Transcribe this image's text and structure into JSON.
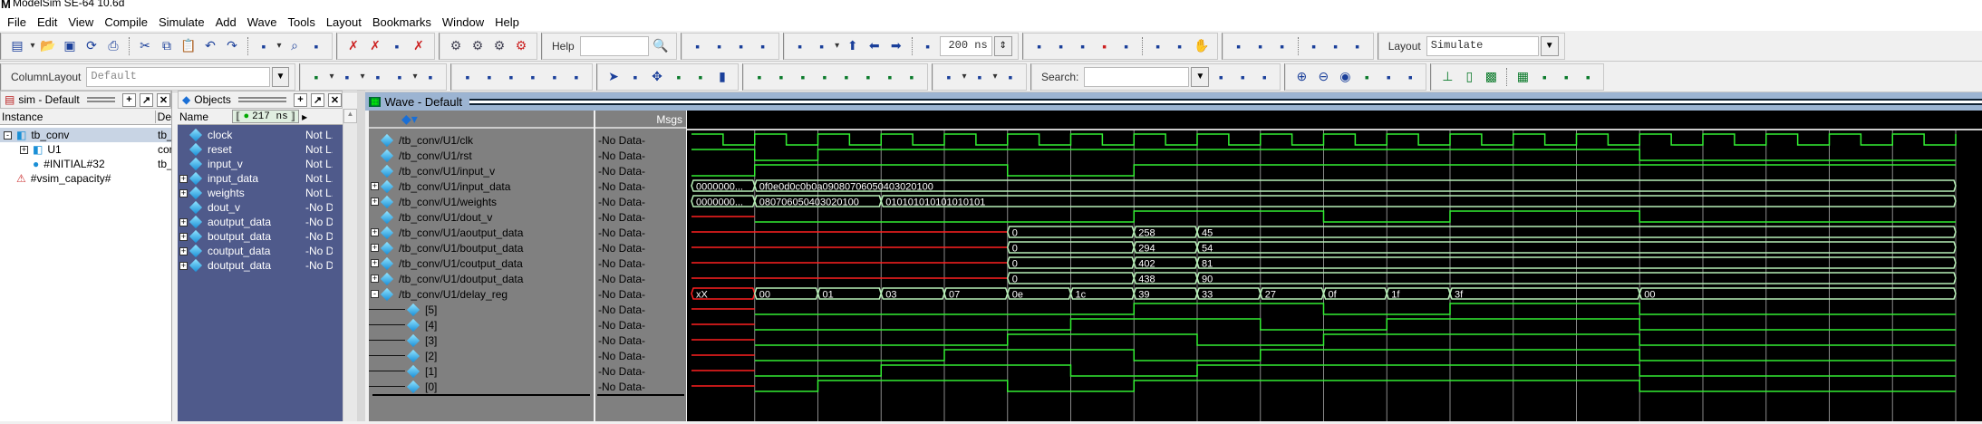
{
  "app": {
    "title": "ModelSim SE-64 10.6d",
    "logo": "M"
  },
  "menu": [
    "File",
    "Edit",
    "View",
    "Compile",
    "Simulate",
    "Add",
    "Wave",
    "Tools",
    "Layout",
    "Bookmarks",
    "Window",
    "Help"
  ],
  "toolbar1": {
    "groups": [
      [
        "new-file-icon",
        "dropdown-arrow-icon",
        "open-folder-icon",
        "save-icon",
        "reload-icon",
        "print-icon",
        "|",
        "cut-icon",
        "copy-icon",
        "paste-icon",
        "undo-icon",
        "redo-icon",
        "|",
        "coverage-icon",
        "dropdown-arrow-icon",
        "find-icon",
        "collapse-icon"
      ],
      [
        "break-icon",
        "step-break-icon",
        "compile-icon",
        "delete-icon"
      ],
      [
        "compile-gear-icon",
        "compile-all-gear-icon",
        "simulate-gear-icon",
        "break-gear-icon"
      ]
    ],
    "help_label": "Help",
    "help_value": "",
    "groups2": [
      [
        "help-search-icon"
      ],
      [
        "load-icon",
        "help-icon",
        "bookmark-icon",
        "close-doc-icon"
      ]
    ],
    "time_groups": [
      [
        "restart-icon",
        "insert-icon",
        "dropdown-arrow-icon",
        "arrow-up-icon",
        "arrow-left-icon",
        "arrow-right-icon",
        "|",
        "time-step-icon"
      ]
    ],
    "run_length": "200 ns",
    "run_groups": [
      [
        "run-icon",
        "continue-icon",
        "run-all-icon",
        "break-run-icon",
        "stop-icon",
        "|",
        "profile-icon",
        "memory-profile-icon",
        "hand-icon"
      ],
      [
        "step-icon",
        "step-over-icon",
        "step-out-icon",
        "|",
        "step-back-icon",
        "step-over-back-icon",
        "step-out-back-icon"
      ]
    ],
    "layout_label": "Layout",
    "layout_value": "Simulate"
  },
  "toolbar2": {
    "column_layout_label": "ColumnLayout",
    "column_layout_value": "Default",
    "groups": [
      [
        "add-wave-icon",
        "dropdown-arrow-icon",
        "add-list-icon",
        "dropdown-arrow-icon",
        "edit-icon",
        "save-format-icon",
        "dropdown-arrow-icon",
        "export-icon"
      ],
      [
        "dataflow-one-icon",
        "dataflow-zero-icon",
        "dataflow-io-icon",
        "dataflow-box-icon",
        "dataflow-all-icon",
        "dataflow-erase-icon"
      ],
      [
        "select-pointer-icon",
        "zoom-box-icon",
        "pan-icon",
        "cursor-pair-icon",
        "cursor-edit-icon",
        "traffic-light-icon"
      ],
      [
        "add-cursor-icon",
        "delete-cursor-icon",
        "prev-cursor-icon",
        "next-cursor-icon",
        "edge-prev-icon",
        "edge-next-icon",
        "edge-falling-icon",
        "edge-rising-icon"
      ],
      [
        "expand-icon",
        "dropdown-arrow-icon",
        "collapse-all-icon",
        "dropdown-arrow-icon",
        "dataflow-link-icon"
      ]
    ],
    "search_label": "Search:",
    "search_value": "",
    "search_groups": [
      [
        "search-prev-icon",
        "search-next-icon",
        "search-options-icon"
      ]
    ],
    "zoom_groups": [
      [
        "zoom-in-icon",
        "zoom-out-icon",
        "zoom-full-icon",
        "zoom-cursor-icon",
        "zoom-between-icon",
        "zoom-area-icon"
      ],
      [
        "wave-line-icon",
        "wave-bar-icon",
        "wave-block-icon",
        "|",
        "wave-hatch-icon",
        "wave-step1-icon",
        "wave-step2-icon",
        "wave-step3-icon"
      ]
    ]
  },
  "sim_pane": {
    "title": "sim - Default",
    "columns": [
      "Instance",
      "De"
    ],
    "rows": [
      {
        "name": "tb_conv",
        "design": "tb_",
        "depth": 0,
        "expand": "-",
        "icon": "module-icon",
        "selected": true
      },
      {
        "name": "U1",
        "design": "cor",
        "depth": 1,
        "expand": "+",
        "icon": "module-icon"
      },
      {
        "name": "#INITIAL#32",
        "design": "tb_",
        "depth": 1,
        "expand": "",
        "icon": "process-icon"
      },
      {
        "name": "#vsim_capacity#",
        "design": "",
        "depth": 0,
        "expand": "",
        "icon": "capacity-icon"
      }
    ]
  },
  "objects_pane": {
    "title": "Objects",
    "name_col": "Name",
    "time": "217 ns",
    "rows": [
      {
        "name": "clock",
        "value": "Not L.",
        "expand": ""
      },
      {
        "name": "reset",
        "value": "Not L.",
        "expand": ""
      },
      {
        "name": "input_v",
        "value": "Not L.",
        "expand": ""
      },
      {
        "name": "input_data",
        "value": "Not L.",
        "expand": "+"
      },
      {
        "name": "weights",
        "value": "Not L.",
        "expand": "+"
      },
      {
        "name": "dout_v",
        "value": "-No D",
        "expand": ""
      },
      {
        "name": "aoutput_data",
        "value": "-No D",
        "expand": "+"
      },
      {
        "name": "boutput_data",
        "value": "-No D",
        "expand": "+"
      },
      {
        "name": "coutput_data",
        "value": "-No D",
        "expand": "+"
      },
      {
        "name": "doutput_data",
        "value": "-No D",
        "expand": "+"
      }
    ]
  },
  "wave_pane": {
    "title": "Wave - Default",
    "msgs_label": "Msgs",
    "colors": {
      "bit": "#33ee33",
      "bus": "#b8f0b8",
      "x": "#ff2020",
      "grid": "#8a8a8a",
      "text": "#ffffff"
    },
    "signals": [
      {
        "name": "/tb_conv/U1/clk",
        "msg": "-No Data-",
        "kind": "clock",
        "expand": ""
      },
      {
        "name": "/tb_conv/U1/rst",
        "msg": "-No Data-",
        "kind": "bit",
        "expand": "",
        "values": [
          1,
          0,
          1,
          1,
          1,
          1,
          1,
          1,
          1,
          1,
          1,
          1,
          1,
          1,
          1,
          0,
          0,
          0,
          0,
          0
        ]
      },
      {
        "name": "/tb_conv/U1/input_v",
        "msg": "-No Data-",
        "kind": "bit",
        "expand": "",
        "values": [
          0,
          1,
          1,
          1,
          1,
          0,
          0,
          1,
          1,
          1,
          1,
          1,
          1,
          1,
          1,
          1,
          1,
          1,
          1,
          1
        ]
      },
      {
        "name": "/tb_conv/U1/input_data",
        "msg": "-No Data-",
        "kind": "bus",
        "expand": "+",
        "values": [
          "0000000...",
          "0f0e0d0c0b0a09080706050403020100",
          "0f0e0d0c0b0a09080706050403020100",
          "0f0e0d0c0b0a09080706050403020100",
          "0f0e0d0c0b0a09080706050403020100",
          "0f0e0d0c0b0a09080706050403020100",
          "0f0e0d0c0b0a09080706050403020100",
          "0f0e0d0c0b0a09080706050403020100",
          "0f0e0d0c0b0a09080706050403020100",
          "0f0e0d0c0b0a09080706050403020100",
          "0f0e0d0c0b0a09080706050403020100",
          "0f0e0d0c0b0a09080706050403020100",
          "0f0e0d0c0b0a09080706050403020100",
          "0f0e0d0c0b0a09080706050403020100",
          "0f0e0d0c0b0a09080706050403020100",
          "0f0e0d0c0b0a09080706050403020100",
          "0f0e0d0c0b0a09080706050403020100",
          "0f0e0d0c0b0a09080706050403020100",
          "0f0e0d0c0b0a09080706050403020100",
          "0f0e0d0c0b0a09080706050403020100"
        ]
      },
      {
        "name": "/tb_conv/U1/weights",
        "msg": "-No Data-",
        "kind": "bus",
        "expand": "+",
        "values": [
          "0000000...",
          "080706050403020100",
          "080706050403020100",
          "010101010101010101",
          "010101010101010101",
          "010101010101010101",
          "010101010101010101",
          "010101010101010101",
          "010101010101010101",
          "010101010101010101",
          "010101010101010101",
          "010101010101010101",
          "010101010101010101",
          "010101010101010101",
          "010101010101010101",
          "010101010101010101",
          "010101010101010101",
          "010101010101010101",
          "010101010101010101",
          "010101010101010101"
        ]
      },
      {
        "name": "/tb_conv/U1/dout_v",
        "msg": "-No Data-",
        "kind": "bit",
        "expand": "",
        "values": [
          "x",
          0,
          0,
          0,
          0,
          0,
          0,
          1,
          1,
          1,
          0,
          0,
          1,
          1,
          1,
          0,
          0,
          0,
          0,
          0
        ]
      },
      {
        "name": "/tb_conv/U1/aoutput_data",
        "msg": "-No Data-",
        "kind": "bus",
        "expand": "+",
        "values": [
          "x",
          "x",
          "x",
          "x",
          "x",
          "0",
          "0",
          "258",
          "45",
          "45",
          "45",
          "45",
          "45",
          "45",
          "45",
          "45",
          "45",
          "45",
          "45",
          "45"
        ]
      },
      {
        "name": "/tb_conv/U1/boutput_data",
        "msg": "-No Data-",
        "kind": "bus",
        "expand": "+",
        "values": [
          "x",
          "x",
          "x",
          "x",
          "x",
          "0",
          "0",
          "294",
          "54",
          "54",
          "54",
          "54",
          "54",
          "54",
          "54",
          "54",
          "54",
          "54",
          "54",
          "54"
        ]
      },
      {
        "name": "/tb_conv/U1/coutput_data",
        "msg": "-No Data-",
        "kind": "bus",
        "expand": "+",
        "values": [
          "x",
          "x",
          "x",
          "x",
          "x",
          "0",
          "0",
          "402",
          "81",
          "81",
          "81",
          "81",
          "81",
          "81",
          "81",
          "81",
          "81",
          "81",
          "81",
          "81"
        ]
      },
      {
        "name": "/tb_conv/U1/doutput_data",
        "msg": "-No Data-",
        "kind": "bus",
        "expand": "+",
        "values": [
          "x",
          "x",
          "x",
          "x",
          "x",
          "0",
          "0",
          "438",
          "90",
          "90",
          "90",
          "90",
          "90",
          "90",
          "90",
          "90",
          "90",
          "90",
          "90",
          "90"
        ]
      },
      {
        "name": "/tb_conv/U1/delay_reg",
        "msg": "-No Data-",
        "kind": "bus",
        "expand": "-",
        "values": [
          "xX",
          "00",
          "01",
          "03",
          "07",
          "0e",
          "1c",
          "39",
          "33",
          "27",
          "0f",
          "1f",
          "3f",
          "3f",
          "3f",
          "00",
          "00",
          "00",
          "00",
          "00"
        ]
      },
      {
        "name": "[5]",
        "msg": "-No Data-",
        "kind": "bit-of",
        "bit": 5,
        "child": true
      },
      {
        "name": "[4]",
        "msg": "-No Data-",
        "kind": "bit-of",
        "bit": 4,
        "child": true
      },
      {
        "name": "[3]",
        "msg": "-No Data-",
        "kind": "bit-of",
        "bit": 3,
        "child": true
      },
      {
        "name": "[2]",
        "msg": "-No Data-",
        "kind": "bit-of",
        "bit": 2,
        "child": true
      },
      {
        "name": "[1]",
        "msg": "-No Data-",
        "kind": "bit-of",
        "bit": 1,
        "child": true
      },
      {
        "name": "[0]",
        "msg": "-No Data-",
        "kind": "bit-of",
        "bit": 0,
        "child": true
      }
    ]
  }
}
